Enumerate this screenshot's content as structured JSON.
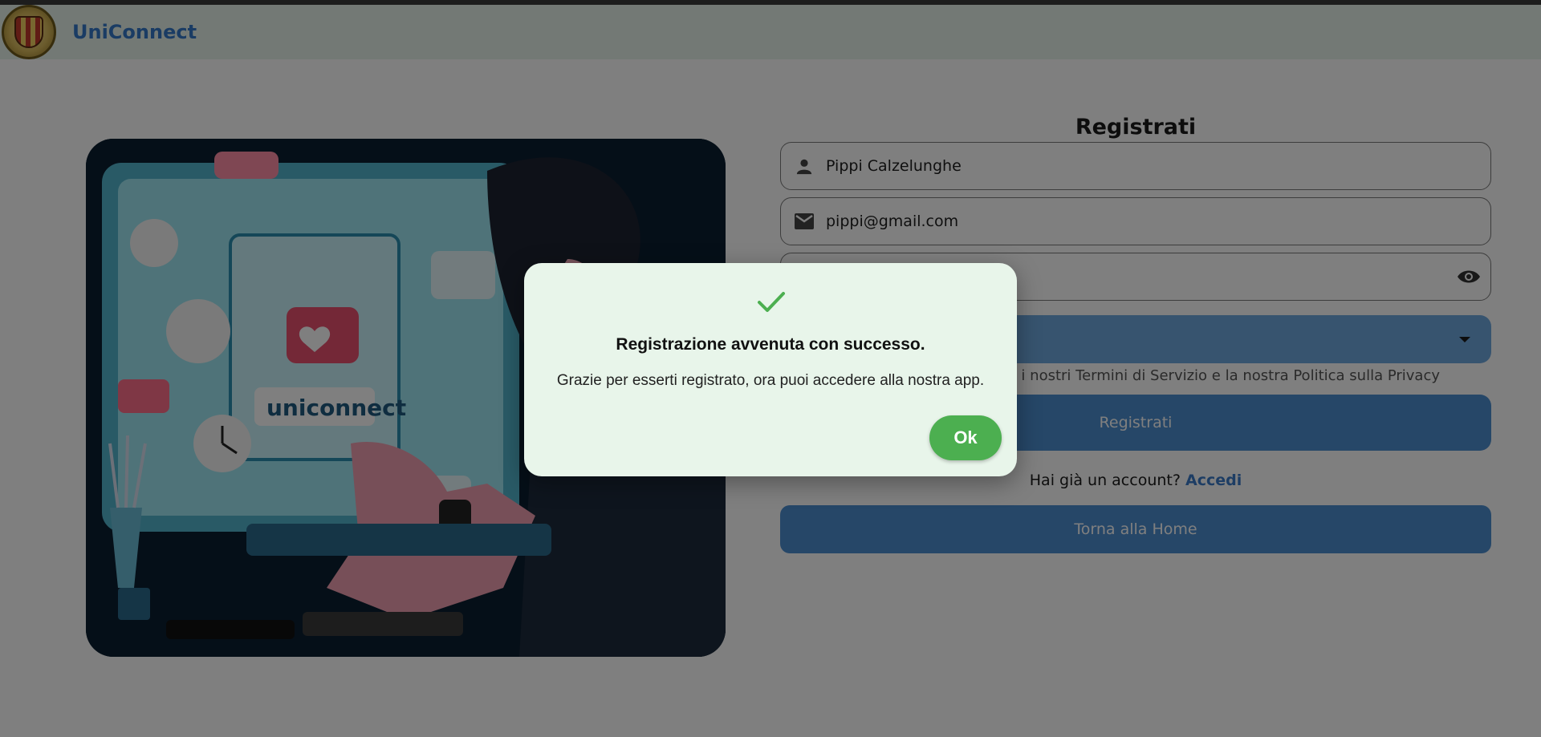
{
  "navbar": {
    "brand": "UniConnect",
    "logo_icon": "university-crest-icon"
  },
  "hero_image": {
    "icon": "social-network-illustration",
    "embedded_text": "uniconnect"
  },
  "form": {
    "title": "Registrati",
    "name_value": "Pippi Calzelunghe",
    "name_icon": "person-icon",
    "email_value": "pippi@gmail.com",
    "email_icon": "mail-icon",
    "password_icon": "eye-icon",
    "select_icon": "caret-down-icon",
    "terms_text": "ti i nostri Termini di Servizio e la nostra Politica sulla Privacy",
    "submit_label": "Registrati",
    "login_prompt": "Hai già un account?",
    "login_link": "Accedi",
    "home_label": "Torna alla Home"
  },
  "dialog": {
    "icon": "check-icon",
    "title": "Registrazione avvenuta con successo.",
    "message": "Grazie per esserti registrato, ora puoi accedere alla nostra app.",
    "ok_label": "Ok"
  },
  "colors": {
    "accent": "#4d8ed0",
    "success": "#4caf50",
    "dialog_bg": "#e8f5ea",
    "navbar_bg": "#e6f2ea",
    "brand": "#3478c8"
  }
}
